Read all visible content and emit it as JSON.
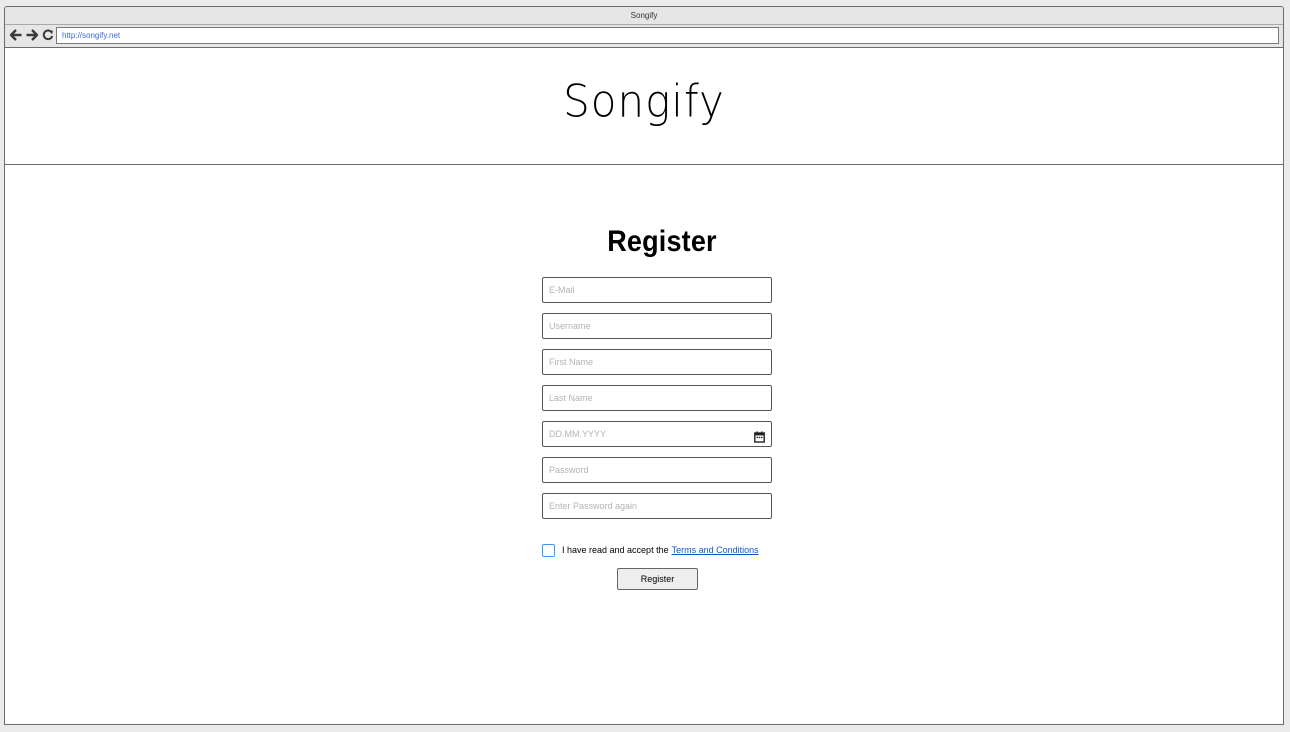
{
  "window": {
    "title": "Songify",
    "url": "http://songify.net"
  },
  "header": {
    "logo_text": "Songify"
  },
  "form": {
    "heading": "Register",
    "fields": [
      {
        "name": "email",
        "placeholder": "E-Mail"
      },
      {
        "name": "username",
        "placeholder": "Username"
      },
      {
        "name": "first-name",
        "placeholder": "First Name"
      },
      {
        "name": "last-name",
        "placeholder": "Last Name"
      },
      {
        "name": "birthdate",
        "placeholder": "DD.MM.YYYY"
      },
      {
        "name": "password",
        "placeholder": "Password"
      },
      {
        "name": "password-repeat",
        "placeholder": "Enter Password again"
      }
    ],
    "terms": {
      "text": "I have read and accept the",
      "link_text": "Terms and Conditions",
      "checked": false
    },
    "submit_label": "Register"
  },
  "icons": {
    "back": "arrow-left-icon",
    "forward": "arrow-right-icon",
    "reload": "reload-icon",
    "calendar": "calendar-icon"
  },
  "colors": {
    "link": "#1155cc",
    "checkbox_border": "#3b99fc",
    "url_text": "#3a6bd6"
  }
}
